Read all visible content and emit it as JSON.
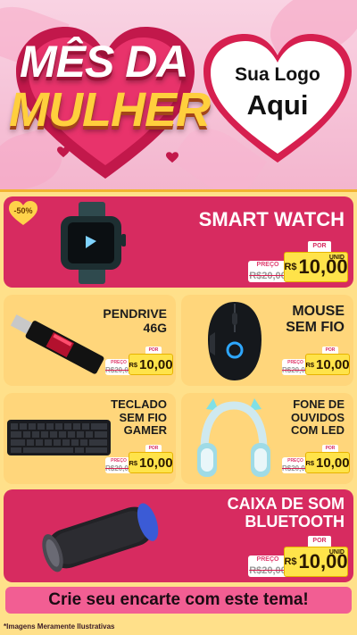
{
  "header": {
    "title_line1": "MÊS DA",
    "title_line2": "MULHER",
    "logo_line1": "Sua Logo",
    "logo_line2": "Aqui"
  },
  "discount_badge": "-50%",
  "price_labels": {
    "old": "PREÇO",
    "new": "POR",
    "unit": "UNID",
    "currency": "R$"
  },
  "products": [
    {
      "name": "SMART WATCH",
      "old_price": "20,00",
      "new_price": "10,00",
      "icon": "smartwatch-icon"
    },
    {
      "name": "PENDRIVE 46G",
      "old_price": "20,00",
      "new_price": "10,00",
      "icon": "usb-drive-icon"
    },
    {
      "name": "MOUSE SEM FIO",
      "old_price": "20,00",
      "new_price": "10,00",
      "icon": "gaming-mouse-icon"
    },
    {
      "name": "TECLADO SEM FIO GAMER",
      "old_price": "20,00",
      "new_price": "10,00",
      "icon": "keyboard-icon"
    },
    {
      "name": "FONE DE OUVIDOS COM LED",
      "old_price": "20,00",
      "new_price": "10,00",
      "icon": "headphones-icon"
    },
    {
      "name": "CAIXA DE SOM BLUETOOTH",
      "old_price": "20,00",
      "new_price": "10,00",
      "icon": "speaker-icon"
    }
  ],
  "banner": "Crie seu encarte com este tema!",
  "footnote": "*Imagens Meramente Ilustrativas",
  "colors": {
    "accent_pink": "#d72b60",
    "cream": "#ffd67b",
    "gold": "#ffcf3d",
    "banner": "#f25e93"
  }
}
